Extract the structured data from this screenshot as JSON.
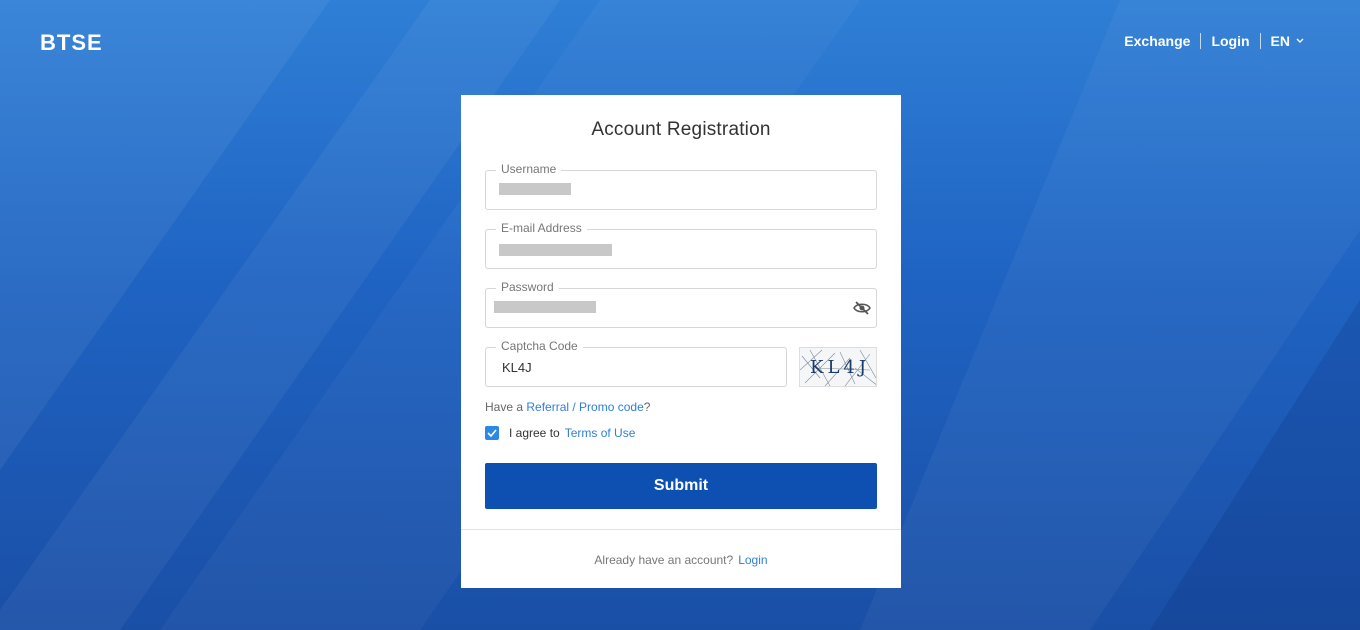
{
  "header": {
    "logo": "BTSE",
    "nav": {
      "exchange": "Exchange",
      "login": "Login",
      "language": "EN"
    }
  },
  "form": {
    "title": "Account Registration",
    "fields": {
      "username": {
        "label": "Username"
      },
      "email": {
        "label": "E-mail Address"
      },
      "password": {
        "label": "Password"
      },
      "captcha": {
        "label": "Captcha Code",
        "value": "KL4J"
      }
    },
    "captcha_image_text": "KL4J",
    "referral": {
      "prefix": "Have a",
      "link": "Referral / Promo code",
      "suffix": "?"
    },
    "agree": {
      "checked": true,
      "text": "I agree to",
      "link": "Terms of Use"
    },
    "submit": "Submit",
    "footer": {
      "text": "Already have an account?",
      "link": "Login"
    }
  },
  "icons": {
    "password_toggle": "eye-off-icon",
    "checkbox": "check-icon",
    "language": "chevron-down-icon"
  },
  "colors": {
    "accent": "#0d50b1",
    "link": "#2f7fd6",
    "checkbox": "#2b88e6",
    "background": "#1f63c2"
  }
}
